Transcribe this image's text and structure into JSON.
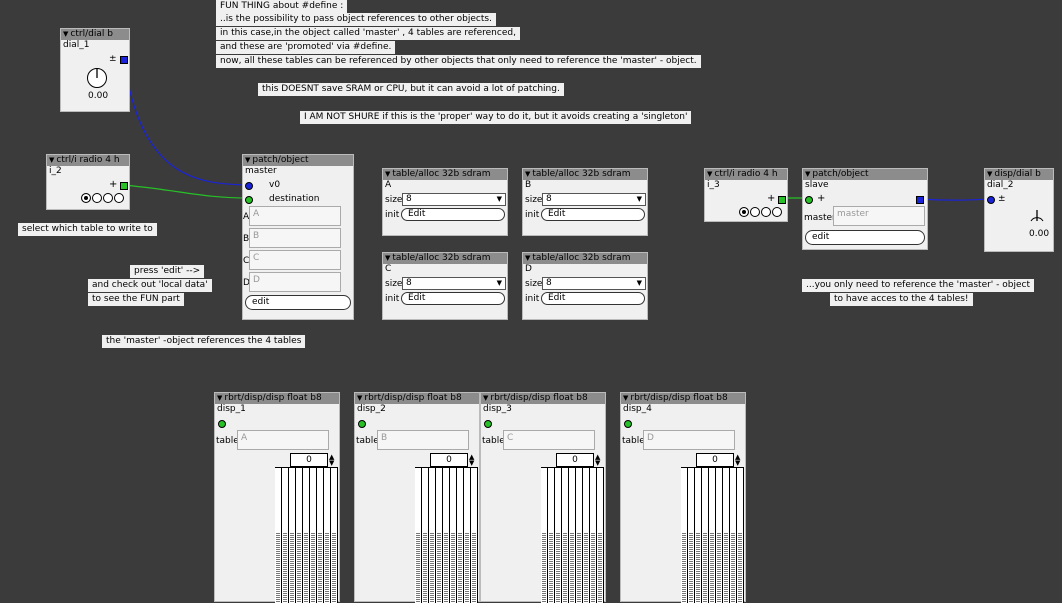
{
  "comments": {
    "fun1": "FUN THING about #define :",
    "fun2": "..is the possibility to pass object references to other objects.",
    "fun3": "in this case,in the object called 'master' , 4 tables are referenced,",
    "fun4": "and these are 'promoted' via #define.",
    "fun5": "now, all these tables can be referenced by other objects that only need to reference the 'master' - object.",
    "sram": "this DOESNT save SRAM or CPU, but it can avoid a lot of patching.",
    "notsure": "I AM NOT SHURE if this is the 'proper' way to do it, but it avoids creating a 'singleton'",
    "select": "select which table to write to",
    "press": "press 'edit' -->",
    "checkout": "and check out 'local data'",
    "seefun": "to see the FUN part",
    "master_ref": "the 'master' -object references the 4 tables",
    "only1": "...you only need to reference the 'master' - object",
    "only2": "to have acces to the 4 tables!"
  },
  "dial1": {
    "type": "ctrl/dial b",
    "name": "dial_1",
    "sign": "±",
    "value": "0.00"
  },
  "radio2": {
    "type": "ctrl/i radio 4 h",
    "name": "i_2",
    "sign": "+"
  },
  "master": {
    "type": "patch/object",
    "name": "master",
    "v0": "v0",
    "destination": "destination",
    "params": [
      {
        "label": "A",
        "value": "A"
      },
      {
        "label": "B",
        "value": "B"
      },
      {
        "label": "C",
        "value": "C"
      },
      {
        "label": "D",
        "value": "D"
      }
    ],
    "edit": "edit"
  },
  "tables": [
    {
      "type": "table/alloc 32b sdram",
      "name": "A",
      "size_label": "size",
      "size": "8",
      "init_label": "init",
      "edit": "Edit"
    },
    {
      "type": "table/alloc 32b sdram",
      "name": "B",
      "size_label": "size",
      "size": "8",
      "init_label": "init",
      "edit": "Edit"
    },
    {
      "type": "table/alloc 32b sdram",
      "name": "C",
      "size_label": "size",
      "size": "8",
      "init_label": "init",
      "edit": "Edit"
    },
    {
      "type": "table/alloc 32b sdram",
      "name": "D",
      "size_label": "size",
      "size": "8",
      "init_label": "init",
      "edit": "Edit"
    }
  ],
  "radio3": {
    "type": "ctrl/i radio 4 h",
    "name": "i_3",
    "sign": "+"
  },
  "slave": {
    "type": "patch/object",
    "name": "slave",
    "sign": "+",
    "master_label": "master",
    "master_value": "master",
    "edit": "edit"
  },
  "dial2": {
    "type": "disp/dial b",
    "name": "dial_2",
    "sign": "±",
    "value": "0.00"
  },
  "disps": [
    {
      "type": "rbrt/disp/disp float b8",
      "name": "disp_1",
      "table_label": "table",
      "table": "A",
      "num": "0"
    },
    {
      "type": "rbrt/disp/disp float b8",
      "name": "disp_2",
      "table_label": "table",
      "table": "B",
      "num": "0"
    },
    {
      "type": "rbrt/disp/disp float b8",
      "name": "disp_3",
      "table_label": "table",
      "table": "C",
      "num": "0"
    },
    {
      "type": "rbrt/disp/disp float b8",
      "name": "disp_4",
      "table_label": "table",
      "table": "D",
      "num": "0"
    }
  ],
  "colors": {
    "background": "#3b3b3b",
    "header": "#8c8c8c",
    "blue_wire": "#1a23d8",
    "green_wire": "#27c127"
  }
}
